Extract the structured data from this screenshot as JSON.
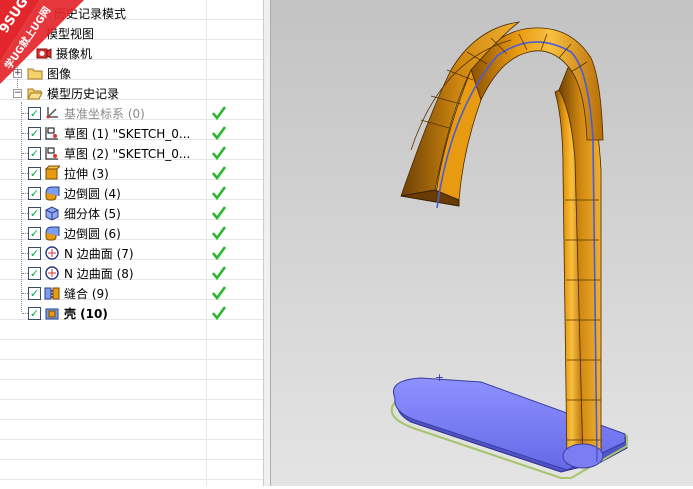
{
  "tree": {
    "top_items": [
      {
        "label": "历史记录模式"
      },
      {
        "label": "模型视图"
      },
      {
        "label": "摄像机"
      },
      {
        "label": "图像"
      },
      {
        "label": "模型历史记录"
      }
    ],
    "features": [
      {
        "label": "基准坐标系 (0)",
        "icon": "datum-csys-icon",
        "checked": true,
        "status": "ok"
      },
      {
        "label": "草图 (1) \"SKETCH_0...",
        "icon": "sketch-icon",
        "checked": true,
        "status": "ok"
      },
      {
        "label": "草图 (2) \"SKETCH_0...",
        "icon": "sketch-icon",
        "checked": true,
        "status": "ok"
      },
      {
        "label": "拉伸 (3)",
        "icon": "extrude-icon",
        "checked": true,
        "status": "ok"
      },
      {
        "label": "边倒圆 (4)",
        "icon": "edge-blend-icon",
        "checked": true,
        "status": "ok"
      },
      {
        "label": "细分体 (5)",
        "icon": "subdivide-body-icon",
        "checked": true,
        "status": "ok"
      },
      {
        "label": "边倒圆 (6)",
        "icon": "edge-blend-icon",
        "checked": true,
        "status": "ok"
      },
      {
        "label": "N 边曲面 (7)",
        "icon": "n-sided-surface-icon",
        "checked": true,
        "status": "ok"
      },
      {
        "label": "N 边曲面 (8)",
        "icon": "n-sided-surface-icon",
        "checked": true,
        "status": "ok"
      },
      {
        "label": "缝合 (9)",
        "icon": "sew-icon",
        "checked": true,
        "status": "ok"
      },
      {
        "label": "壳 (10)",
        "icon": "shell-icon",
        "checked": true,
        "status": "ok"
      }
    ]
  },
  "watermark": {
    "line1": "9SUG",
    "line2": "学UG就上UG网"
  },
  "colors": {
    "faucet_orange": "#e89a10",
    "faucet_dark": "#7a4a05",
    "base_blue": "#7b7ef0",
    "check_green": "#2fb52f",
    "edge_green": "#a6c46a"
  }
}
